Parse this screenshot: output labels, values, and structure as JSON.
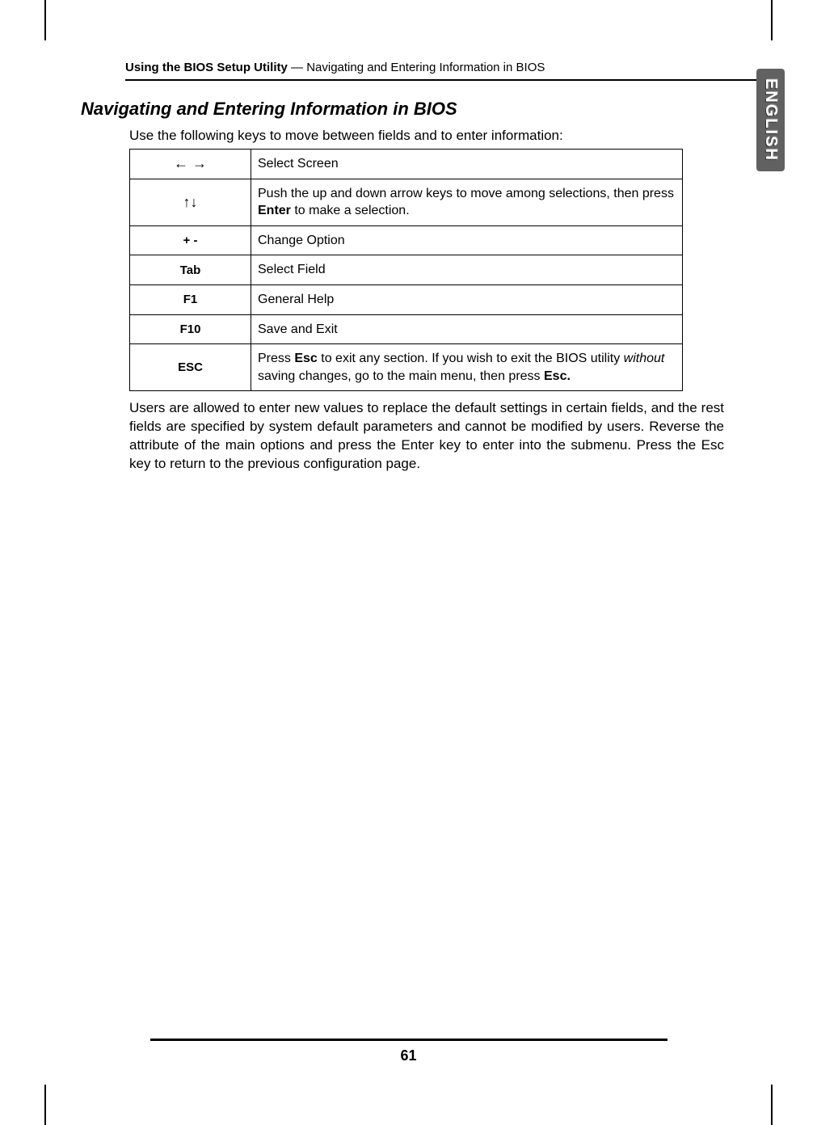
{
  "header": {
    "bold_part": "Using the BIOS Setup Utility",
    "normal_part": " — Navigating and Entering Information in BIOS"
  },
  "side_tab": "ENGLISH",
  "section_title": "Navigating and Entering Information in BIOS",
  "intro_text": "Use the following keys to move between fields and to enter information:",
  "table": {
    "rows": [
      {
        "key": "←  →",
        "desc_plain": "Select Screen"
      },
      {
        "key": "↑↓",
        "desc_prefix": "Push the up and down arrow keys to move among selections, then press ",
        "desc_bold": "Enter",
        "desc_suffix": " to make a selection."
      },
      {
        "key": "+  -",
        "desc_plain": "Change Option"
      },
      {
        "key": "Tab",
        "desc_plain": "Select Field"
      },
      {
        "key": "F1",
        "desc_plain": "General Help"
      },
      {
        "key": "F10",
        "desc_plain": "Save and Exit"
      },
      {
        "key": "ESC",
        "desc_p1": "Press ",
        "desc_b1": "Esc",
        "desc_p2": " to exit any section. If you wish to exit the BIOS utility ",
        "desc_i1": "without",
        "desc_p3": " saving changes, go to the main menu, then press ",
        "desc_b2": "Esc."
      }
    ]
  },
  "body_text": "Users are allowed to enter new values to replace the default settings in certain fields, and the rest fields are specified by system default parameters and cannot be modified by users. Reverse the attribute of the main options and press the Enter key to enter into the submenu. Press the Esc key to return to the previous configuration page.",
  "page_number": "61"
}
